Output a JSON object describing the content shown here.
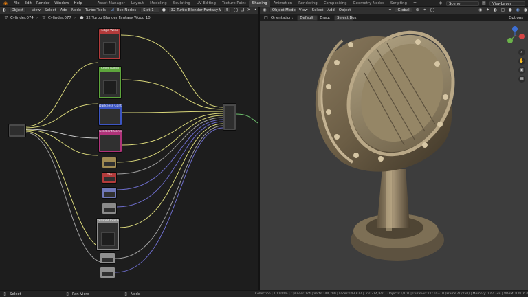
{
  "topbar": {
    "menus": [
      "File",
      "Edit",
      "Render",
      "Window",
      "Help"
    ],
    "workspaces": [
      "Asset Manager",
      "Layout",
      "Modeling",
      "Sculpting",
      "UV Editing",
      "Texture Paint",
      "Shading",
      "Animation",
      "Rendering",
      "Compositing",
      "Geometry Nodes",
      "Scripting"
    ],
    "active_workspace": "Shading",
    "scene": "Scene",
    "view_layer": "ViewLayer"
  },
  "node_header": {
    "mode": "Object",
    "menus": [
      "View",
      "Select",
      "Add",
      "Node"
    ],
    "turbo_tools": "Turbo Tools",
    "use_nodes": "Use Nodes",
    "slot": "Slot 1",
    "material": "32 Turbo Blender Fantasy Wood 10",
    "user_count": "5"
  },
  "breadcrumb": [
    "Cylinder.074",
    "Cylinder.077",
    "32 Turbo Blender Fantasy Wood 10"
  ],
  "nodes": [
    {
      "label": "Edge Wear",
      "color": "#b33b3b"
    },
    {
      "label": "Color Ramp",
      "color": "#5da53c"
    },
    {
      "label": "Darkness Control",
      "color": "#3c55c3"
    },
    {
      "label": "Gradient Control",
      "color": "#b0337a"
    },
    {
      "label": "",
      "color": "#a08a52"
    },
    {
      "label": "Mix",
      "color": "#b33b3b"
    },
    {
      "label": "",
      "color": "#6f78b8"
    },
    {
      "label": "",
      "color": "#8a8a8a"
    },
    {
      "label": "Variation Control",
      "color": "#8f8f8f"
    },
    {
      "label": "",
      "color": "#8f8f8f"
    },
    {
      "label": "",
      "color": "#8f8f8f"
    }
  ],
  "viewport_header": {
    "mode": "Object Mode",
    "menus": [
      "View",
      "Select",
      "Add",
      "Object"
    ],
    "transform": "Global",
    "options": "Options"
  },
  "viewport_subheader": {
    "orientation_label": "Orientation:",
    "orientation": "Default",
    "drag_label": "Drag:",
    "drag": "Select Box"
  },
  "status": {
    "left": [
      {
        "key": "Select"
      },
      {
        "key": "Pan View"
      },
      {
        "key": "Node"
      }
    ],
    "right": "Collection | 100.00% | Cylinder.074 | Verts:144,290 | Faces:143,822 | Tris:214,840 | Objects:1/101 | Duration: 00:10+10 (Frame 40/250) | Memory: 1.64 GiB | VRAM: 8.0/16.0 GiB | 4.1"
  },
  "colors": {
    "wire_yellow": "#d9d77a",
    "wire_gray": "#a0a0a0",
    "wire_blue": "#6c6cc9",
    "wire_green": "#6cbe6c",
    "accent": "#e87d0d"
  }
}
